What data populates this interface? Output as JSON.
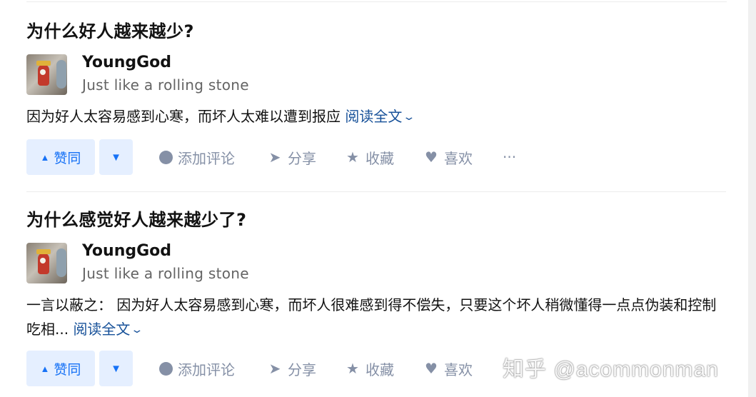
{
  "answers": [
    {
      "question_title": "为什么好人越来越少?",
      "author_name": "YoungGod",
      "author_bio": "Just like a rolling stone",
      "excerpt": "因为好人太容易感到心寒，而坏人太难以遭到报应",
      "read_more": "阅读全文"
    },
    {
      "question_title": "为什么感觉好人越来越少了?",
      "author_name": "YoungGod",
      "author_bio": "Just like a rolling stone",
      "excerpt": "一言以蔽之： 因为好人太容易感到心寒，而坏人很难感到得不偿失，只要这个坏人稍微懂得一点点伪装和控制吃相...",
      "read_more": "阅读全文"
    }
  ],
  "actions": {
    "upvote": "赞同",
    "comment": "添加评论",
    "share": "分享",
    "favorite": "收藏",
    "like": "喜欢",
    "more": "···"
  },
  "icons": {
    "upvote": "triangle-up-icon",
    "downvote": "triangle-down-icon",
    "comment": "comment-bubble-icon",
    "share": "paper-plane-icon",
    "favorite": "star-icon",
    "like": "heart-icon",
    "read_more": "chevron-down-icon"
  },
  "watermark": "知乎 @acommonman",
  "colors": {
    "link": "#175199",
    "upvote_bg": "#e5efff",
    "upvote_text": "#1772f6",
    "action_gray": "#8590a6"
  }
}
